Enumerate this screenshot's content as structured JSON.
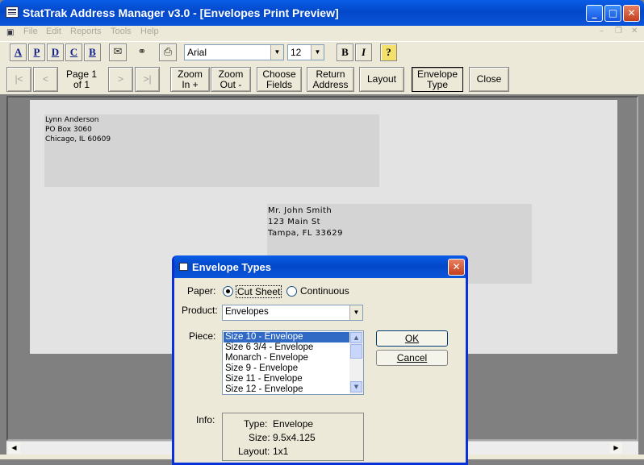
{
  "app": {
    "title": "StatTrak Address Manager v3.0 - [Envelopes Print Preview]"
  },
  "menu": [
    "File",
    "Edit",
    "Reports",
    "Tools",
    "Help"
  ],
  "toolbar1": {
    "letters": [
      "A",
      "P",
      "D",
      "C",
      "B"
    ],
    "font": "Arial",
    "size": "12",
    "bold": "B",
    "italic": "I",
    "help": "?"
  },
  "toolbar2": {
    "first": "|<",
    "prev": "<",
    "page_line1": "Page 1",
    "page_line2": "of 1",
    "next": ">",
    "last": ">|",
    "zoom_in_1": "Zoom",
    "zoom_in_2": "In +",
    "zoom_out_1": "Zoom",
    "zoom_out_2": "Out -",
    "choose_1": "Choose",
    "choose_2": "Fields",
    "return_1": "Return",
    "return_2": "Address",
    "layout": "Layout",
    "envtype_1": "Envelope",
    "envtype_2": "Type",
    "close": "Close"
  },
  "envelope": {
    "return": [
      "Lynn Anderson",
      "PO Box 3060",
      "Chicago, IL 60609"
    ],
    "dest": [
      "Mr. John Smith",
      "123 Main St",
      "Tampa, FL 33629"
    ]
  },
  "dialog": {
    "title": "Envelope Types",
    "paper_label": "Paper:",
    "paper_cut": "Cut Sheet",
    "paper_cont": "Continuous",
    "product_label": "Product:",
    "product_value": "Envelopes",
    "piece_label": "Piece:",
    "pieces": [
      "Size 10 - Envelope",
      "Size 6 3/4 - Envelope",
      "Monarch - Envelope",
      "Size 9 - Envelope",
      "Size 11 - Envelope",
      "Size 12 - Envelope"
    ],
    "ok": "OK",
    "cancel": "Cancel",
    "info_label": "Info:",
    "type_label": "Type:",
    "type_value": "Envelope",
    "size_label": "Size:",
    "size_value": "9.5x4.125",
    "layout_label": "Layout:",
    "layout_value": "1x1"
  }
}
